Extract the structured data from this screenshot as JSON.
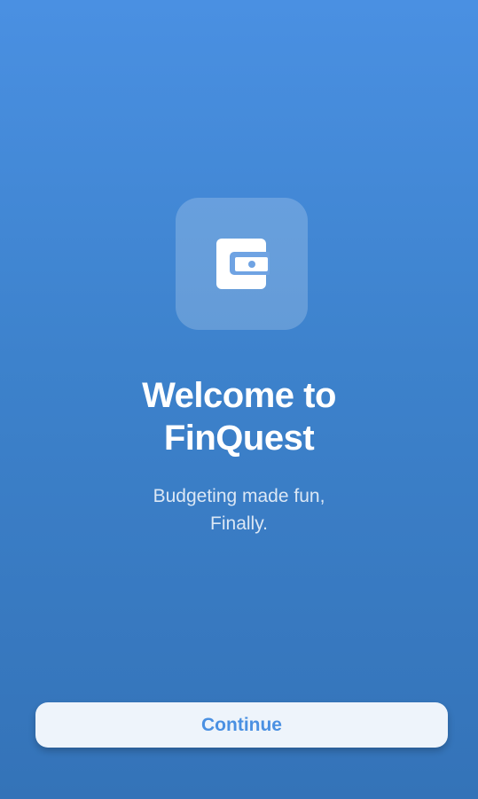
{
  "app": {
    "logo_icon": "wallet-icon",
    "title_line1": "Welcome to",
    "title_line2": "FinQuest",
    "subtitle_line1": "Budgeting made fun,",
    "subtitle_line2": "Finally."
  },
  "actions": {
    "continue_label": "Continue"
  },
  "colors": {
    "background_top": "#4a90e2",
    "background_bottom": "#3473b8",
    "button_bg": "#eef4fb",
    "button_text": "#4a90e2"
  }
}
